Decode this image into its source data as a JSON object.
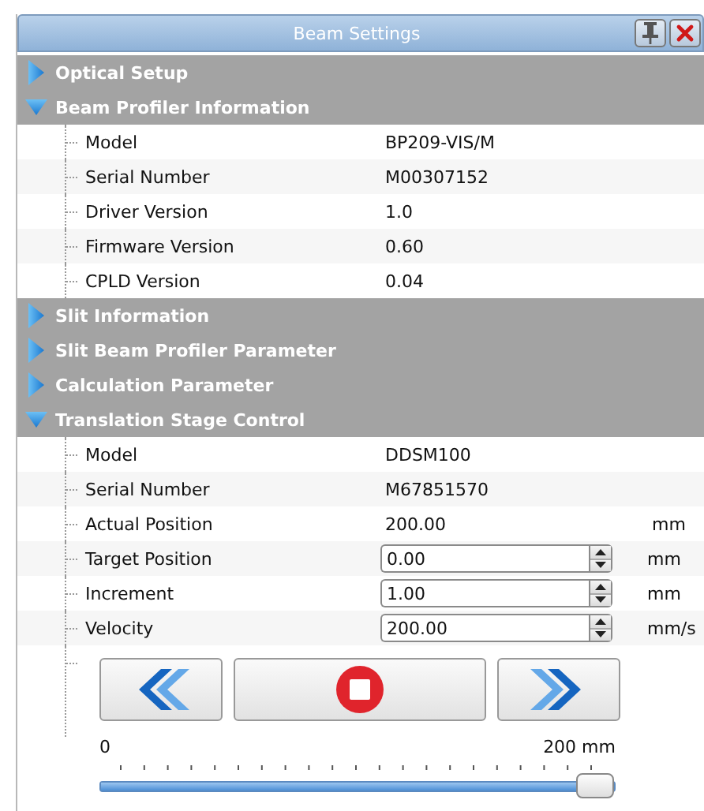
{
  "window": {
    "title": "Beam Settings"
  },
  "sections": [
    {
      "title": "Optical Setup",
      "expanded": false
    },
    {
      "title": "Beam Profiler Information",
      "expanded": true,
      "rows": [
        {
          "kind": "text",
          "label": "Model",
          "value": "BP209-VIS/M"
        },
        {
          "kind": "text",
          "label": "Serial Number",
          "value": "M00307152"
        },
        {
          "kind": "text",
          "label": "Driver Version",
          "value": "1.0"
        },
        {
          "kind": "text",
          "label": "Firmware Version",
          "value": "0.60"
        },
        {
          "kind": "text",
          "label": "CPLD Version",
          "value": "0.04"
        }
      ]
    },
    {
      "title": "Slit Information",
      "expanded": false
    },
    {
      "title": "Slit Beam Profiler Parameter",
      "expanded": false
    },
    {
      "title": "Calculation Parameter",
      "expanded": false
    },
    {
      "title": "Translation Stage Control",
      "expanded": true,
      "rows": [
        {
          "kind": "text",
          "label": "Model",
          "value": "DDSM100"
        },
        {
          "kind": "text",
          "label": "Serial Number",
          "value": "M67851570"
        },
        {
          "kind": "text",
          "label": "Actual Position",
          "value": "200.00",
          "unit": "mm"
        },
        {
          "kind": "spin",
          "label": "Target Position",
          "value": "0.00",
          "unit": "mm"
        },
        {
          "kind": "spin",
          "label": "Increment",
          "value": "1.00",
          "unit": "mm"
        },
        {
          "kind": "spin",
          "label": "Velocity",
          "value": "200.00",
          "unit": "mm/s"
        }
      ],
      "slider": {
        "min_label": "0",
        "max_label": "200 mm",
        "level": 1.0
      }
    }
  ]
}
